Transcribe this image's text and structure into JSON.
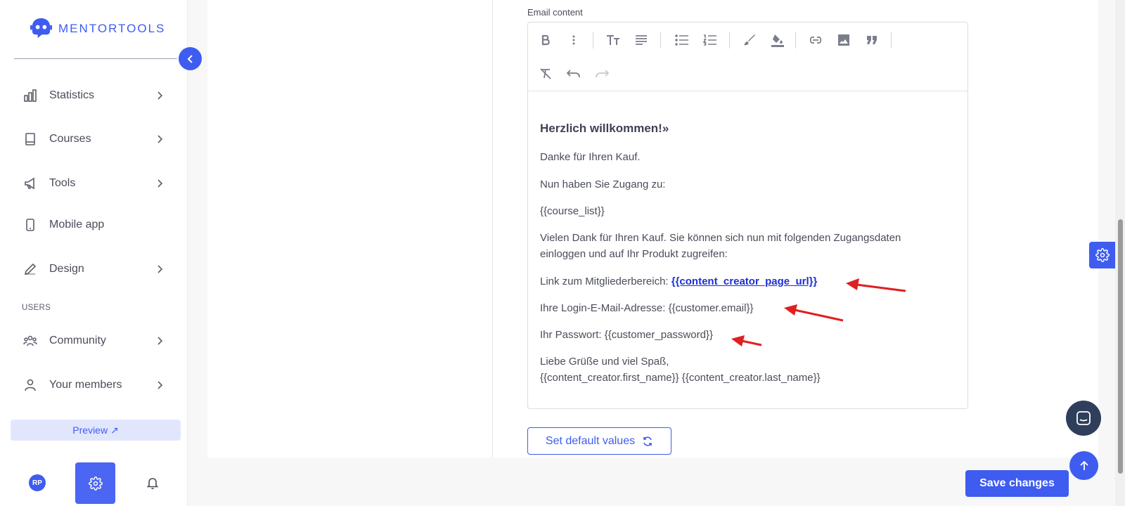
{
  "brand": {
    "name": "MENTORTOOLS",
    "color": "#3e5cf0"
  },
  "sidebar": {
    "items": [
      {
        "label": "Statistics",
        "icon": "bar-chart-icon",
        "has_chevron": true
      },
      {
        "label": "Courses",
        "icon": "book-icon",
        "has_chevron": true
      },
      {
        "label": "Tools",
        "icon": "megaphone-icon",
        "has_chevron": true
      },
      {
        "label": "Mobile app",
        "icon": "smartphone-icon",
        "has_chevron": false
      },
      {
        "label": "Design",
        "icon": "pencil-icon",
        "has_chevron": true
      }
    ],
    "users_section_label": "USERS",
    "user_items": [
      {
        "label": "Community",
        "icon": "people-icon",
        "has_chevron": true
      },
      {
        "label": "Your members",
        "icon": "user-icon",
        "has_chevron": true
      }
    ],
    "preview_label": "Preview ↗",
    "avatar_initials": "RP"
  },
  "editor": {
    "field_label": "Email content",
    "toolbar": [
      "bold-icon",
      "more-vertical-icon",
      "text-size-icon",
      "align-icon",
      "bullet-list-icon",
      "numbered-list-icon",
      "brush-icon",
      "fill-color-icon",
      "link-icon",
      "image-icon",
      "quote-icon",
      "clear-format-icon",
      "undo-icon",
      "redo-icon"
    ],
    "content": {
      "heading": "Herzlich willkommen!»",
      "line1": "Danke für Ihren Kauf.",
      "line2": "Nun haben Sie Zugang zu:",
      "line3": " {{course_list}}",
      "para1_a": "Vielen Dank für Ihren Kauf. Sie können sich nun mit folgenden Zugangsdaten",
      "para1_b": "einloggen und auf Ihr Produkt zugreifen:",
      "link_prefix": "Link zum Mitgliederbereich: ",
      "link_text": "{{content_creator_page_url}}",
      "email_line": "Ihre Login-E-Mail-Adresse: {{customer.email}}",
      "password_line": "Ihr Passwort: {{customer_password}}",
      "closing_a": "Liebe Grüße und viel Spaß,",
      "closing_b": "{{content_creator.first_name}} {{content_creator.last_name}}"
    }
  },
  "buttons": {
    "set_default": "Set default values",
    "save": "Save changes"
  },
  "annotation_color": "#e02020"
}
